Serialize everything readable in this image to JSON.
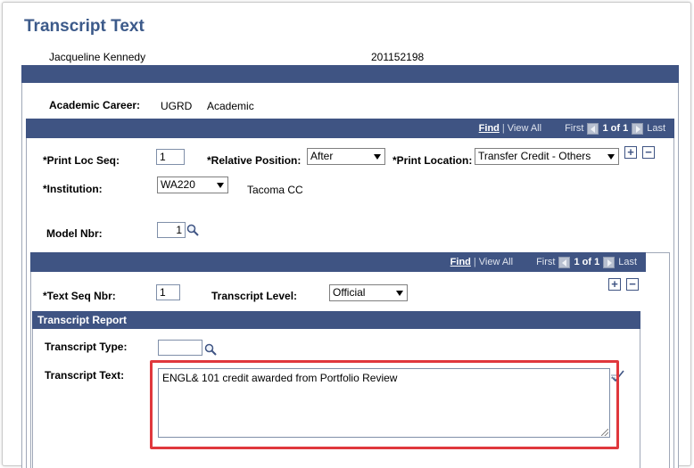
{
  "page": {
    "title": "Transcript Text",
    "student_name": "Jacqueline Kennedy",
    "student_id": "201152198"
  },
  "career": {
    "label": "Academic Career:",
    "code": "UGRD",
    "description": "Academic"
  },
  "nav1": {
    "find": "Find",
    "sep": "|",
    "view_all": "View All",
    "first": "First",
    "count": "1 of 1",
    "last": "Last"
  },
  "print_loc": {
    "seq_label": "*Print Loc Seq:",
    "seq_value": "1",
    "rel_pos_label": "*Relative Position:",
    "rel_pos_value": "After",
    "print_location_label": "*Print Location:",
    "print_location_value": "Transfer Credit - Others",
    "add": "+",
    "remove": "−"
  },
  "institution": {
    "label": "*Institution:",
    "value": "WA220",
    "description": "Tacoma CC"
  },
  "model": {
    "label": "Model Nbr:",
    "value": "1"
  },
  "nav2": {
    "find": "Find",
    "sep": "|",
    "view_all": "View All",
    "first": "First",
    "count": "1 of 1",
    "last": "Last"
  },
  "text_seq": {
    "label": "*Text Seq Nbr:",
    "value": "1",
    "level_label": "Transcript Level:",
    "level_value": "Official",
    "add": "+",
    "remove": "−"
  },
  "report": {
    "header": "Transcript Report",
    "type_label": "Transcript Type:",
    "type_value": "",
    "text_label": "Transcript Text:",
    "text_value": "ENGL& 101 credit awarded from Portfolio Review"
  },
  "colors": {
    "header_bar": "#3f5483",
    "title": "#3c5a8a",
    "highlight": "#e0383d"
  },
  "icons": {
    "lookup": "magnifier-icon",
    "spell": "spell-check-icon",
    "prev": "arrow-left-icon",
    "next": "arrow-right-icon"
  }
}
